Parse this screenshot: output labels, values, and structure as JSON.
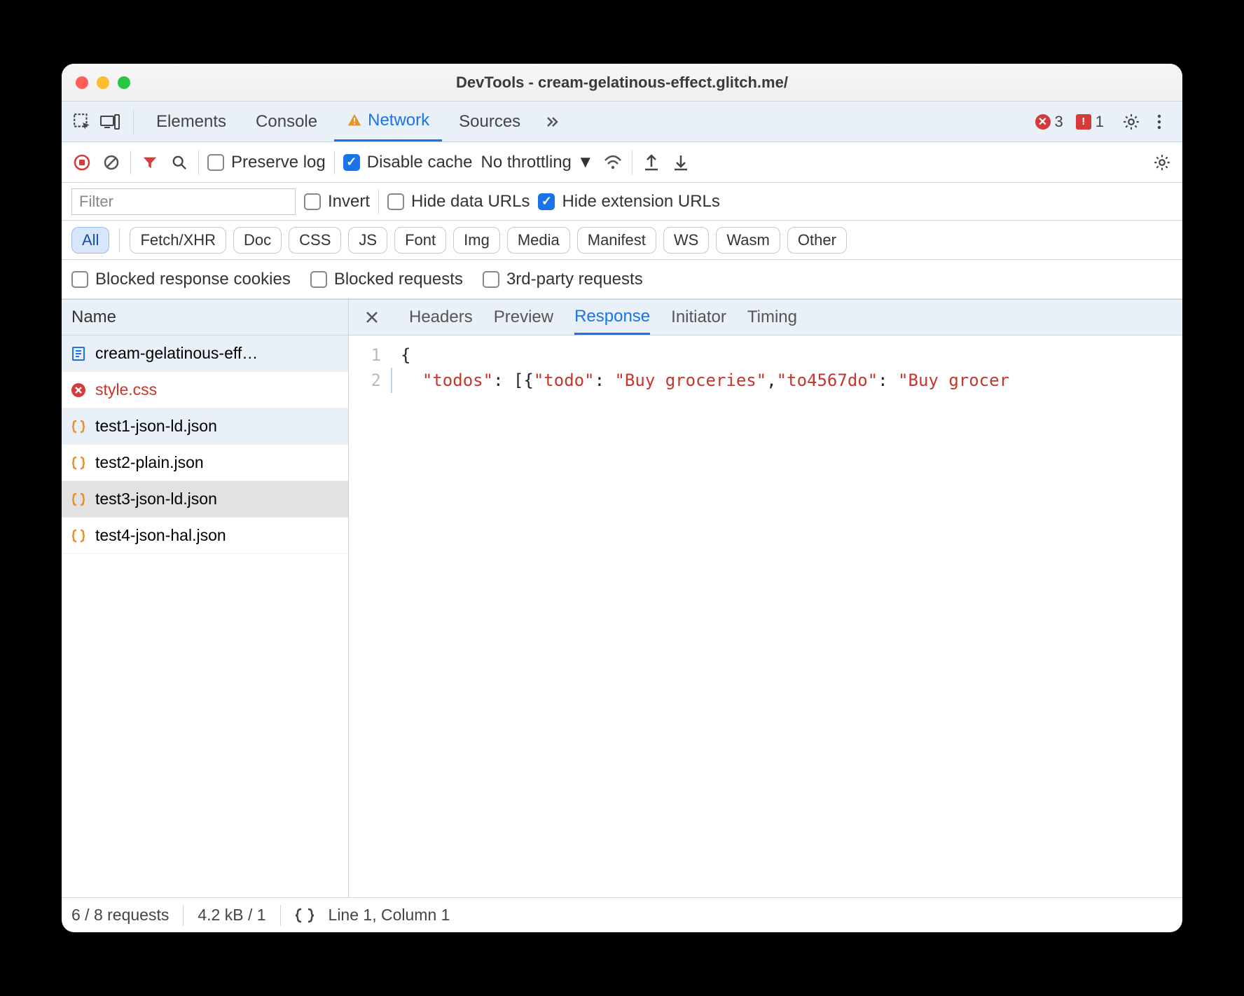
{
  "window": {
    "title": "DevTools - cream-gelatinous-effect.glitch.me/"
  },
  "tabs": {
    "elements": "Elements",
    "console": "Console",
    "network": "Network",
    "sources": "Sources"
  },
  "counters": {
    "errors": "3",
    "issues": "1"
  },
  "toolbar": {
    "preserve_log": "Preserve log",
    "disable_cache": "Disable cache",
    "throttling": "No throttling"
  },
  "filter": {
    "placeholder": "Filter",
    "invert": "Invert",
    "hide_data": "Hide data URLs",
    "hide_ext": "Hide extension URLs"
  },
  "type_filters": [
    "All",
    "Fetch/XHR",
    "Doc",
    "CSS",
    "JS",
    "Font",
    "Img",
    "Media",
    "Manifest",
    "WS",
    "Wasm",
    "Other"
  ],
  "more_filters": {
    "blocked_cookies": "Blocked response cookies",
    "blocked_requests": "Blocked requests",
    "third_party": "3rd-party requests"
  },
  "left": {
    "header": "Name"
  },
  "requests": [
    {
      "name": "cream-gelatinous-eff…",
      "icon": "doc",
      "state": "hl"
    },
    {
      "name": "style.css",
      "icon": "error",
      "state": "err"
    },
    {
      "name": "test1-json-ld.json",
      "icon": "json",
      "state": "hl"
    },
    {
      "name": "test2-plain.json",
      "icon": "json",
      "state": ""
    },
    {
      "name": "test3-json-ld.json",
      "icon": "json",
      "state": "sel"
    },
    {
      "name": "test4-json-hal.json",
      "icon": "json",
      "state": ""
    }
  ],
  "detail_tabs": [
    "Headers",
    "Preview",
    "Response",
    "Initiator",
    "Timing"
  ],
  "code": {
    "lines": [
      "1",
      "2"
    ],
    "l1": "{",
    "l2_k1": "\"todos\"",
    "l2_p1": ": [{",
    "l2_k2": "\"todo\"",
    "l2_p2": ": ",
    "l2_s1": "\"Buy groceries\"",
    "l2_p3": ",",
    "l2_k3": "\"to4567do\"",
    "l2_p4": ": ",
    "l2_s2": "\"Buy grocer"
  },
  "status": {
    "requests": "6 / 8 requests",
    "transfer": "4.2 kB / 1",
    "cursor": "Line 1, Column 1"
  }
}
